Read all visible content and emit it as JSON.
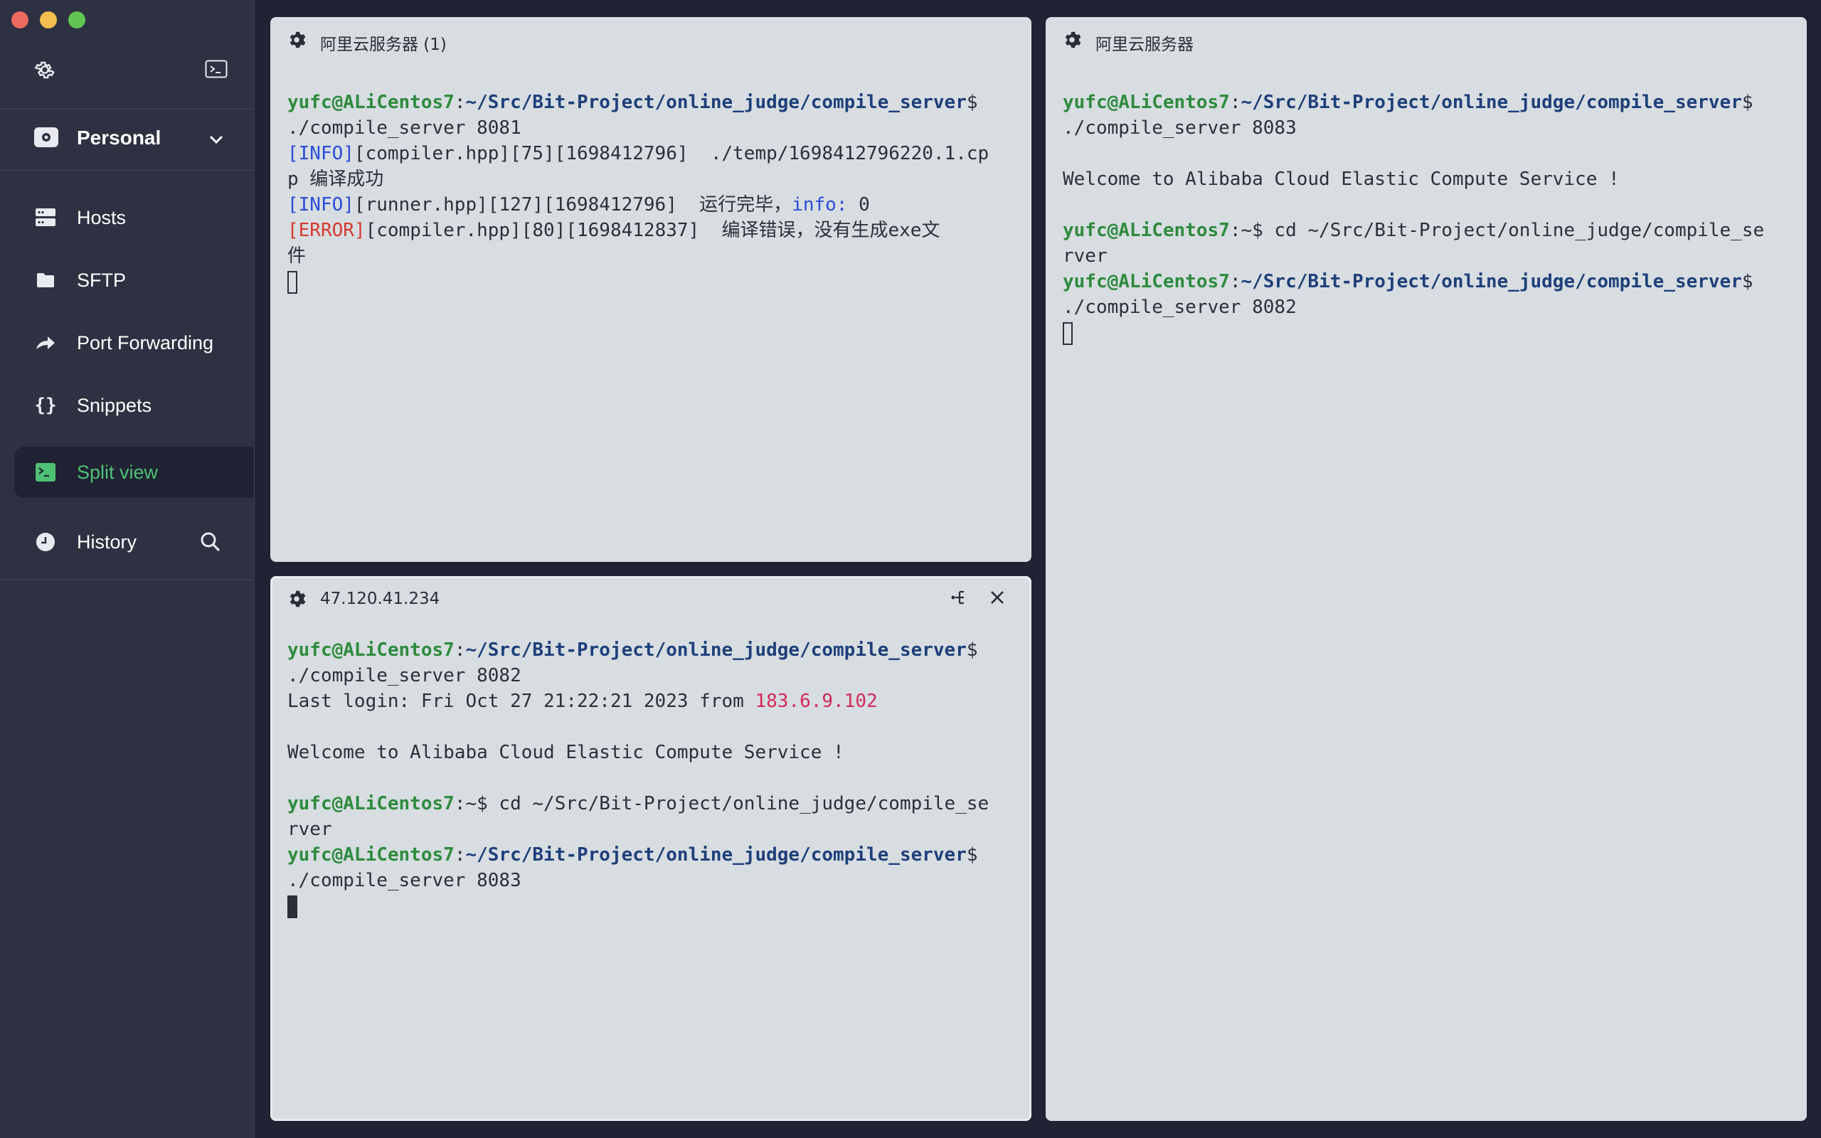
{
  "sidebar": {
    "vault_label": "Personal",
    "items": [
      {
        "label": "Hosts"
      },
      {
        "label": "SFTP"
      },
      {
        "label": "Port Forwarding"
      },
      {
        "label": "Snippets"
      },
      {
        "label": "Split view"
      },
      {
        "label": "History"
      }
    ],
    "active_item": "Split view",
    "colors": {
      "background": "#2e3141",
      "active_bg": "#1f2333",
      "active_text": "#4fc174"
    }
  },
  "panels": {
    "top_left": {
      "title": "阿里云服务器 (1)",
      "lines": [
        [
          {
            "t": "yufc@ALiCentos7",
            "c": "u"
          },
          {
            "t": ":",
            "c": ""
          },
          {
            "t": "~/Src/Bit-Project/online_judge/compile_server",
            "c": "p"
          },
          {
            "t": "$",
            "c": ""
          }
        ],
        [
          {
            "t": "./compile_server 8081",
            "c": ""
          }
        ],
        [
          {
            "t": "[INFO]",
            "c": "info"
          },
          {
            "t": "[compiler.hpp][75][1698412796]  ./temp/1698412796220.1.cp",
            "c": ""
          }
        ],
        [
          {
            "t": "p 编译成功",
            "c": ""
          }
        ],
        [
          {
            "t": "[INFO]",
            "c": "info"
          },
          {
            "t": "[runner.hpp][127][1698412796]  运行完毕，",
            "c": ""
          },
          {
            "t": "info:",
            "c": "info"
          },
          {
            "t": " 0",
            "c": ""
          }
        ],
        [
          {
            "t": "[ERROR]",
            "c": "err"
          },
          {
            "t": "[compiler.hpp][80][1698412837]  编译错误，没有生成exe文",
            "c": ""
          }
        ],
        [
          {
            "t": "件",
            "c": ""
          }
        ]
      ],
      "cursor": "hollow"
    },
    "bottom_left": {
      "title": "47.120.41.234",
      "lines": [
        [
          {
            "t": "yufc@ALiCentos7",
            "c": "u"
          },
          {
            "t": ":",
            "c": ""
          },
          {
            "t": "~/Src/Bit-Project/online_judge/compile_server",
            "c": "p"
          },
          {
            "t": "$",
            "c": ""
          }
        ],
        [
          {
            "t": "./compile_server 8082",
            "c": ""
          }
        ],
        [
          {
            "t": "Last login: Fri Oct 27 21:22:21 2023 from ",
            "c": ""
          },
          {
            "t": "183.6.9.102",
            "c": "ip"
          }
        ],
        [
          {
            "t": "",
            "c": ""
          }
        ],
        [
          {
            "t": "Welcome to Alibaba Cloud Elastic Compute Service !",
            "c": ""
          }
        ],
        [
          {
            "t": "",
            "c": ""
          }
        ],
        [
          {
            "t": "yufc@ALiCentos7",
            "c": "u"
          },
          {
            "t": ":~$ cd ~/Src/Bit-Project/online_judge/compile_se",
            "c": ""
          }
        ],
        [
          {
            "t": "rver",
            "c": ""
          }
        ],
        [
          {
            "t": "yufc@ALiCentos7",
            "c": "u"
          },
          {
            "t": ":",
            "c": ""
          },
          {
            "t": "~/Src/Bit-Project/online_judge/compile_server",
            "c": "p"
          },
          {
            "t": "$",
            "c": ""
          }
        ],
        [
          {
            "t": "./compile_server 8083",
            "c": ""
          }
        ]
      ],
      "cursor": "filled"
    },
    "right": {
      "title": "阿里云服务器",
      "lines": [
        [
          {
            "t": "yufc@ALiCentos7",
            "c": "u"
          },
          {
            "t": ":",
            "c": ""
          },
          {
            "t": "~/Src/Bit-Project/online_judge/compile_server",
            "c": "p"
          },
          {
            "t": "$",
            "c": ""
          }
        ],
        [
          {
            "t": "./compile_server 8083",
            "c": ""
          }
        ],
        [
          {
            "t": "",
            "c": ""
          }
        ],
        [
          {
            "t": "Welcome to Alibaba Cloud Elastic Compute Service !",
            "c": ""
          }
        ],
        [
          {
            "t": "",
            "c": ""
          }
        ],
        [
          {
            "t": "yufc@ALiCentos7",
            "c": "u"
          },
          {
            "t": ":~$ cd ~/Src/Bit-Project/online_judge/compile_se",
            "c": ""
          }
        ],
        [
          {
            "t": "rver",
            "c": ""
          }
        ],
        [
          {
            "t": "yufc@ALiCentos7",
            "c": "u"
          },
          {
            "t": ":",
            "c": ""
          },
          {
            "t": "~/Src/Bit-Project/online_judge/compile_server",
            "c": "p"
          },
          {
            "t": "$",
            "c": ""
          }
        ],
        [
          {
            "t": "./compile_server 8082",
            "c": ""
          }
        ]
      ],
      "cursor": "hollow"
    }
  },
  "icons": [
    "gear-icon",
    "terminal-icon",
    "vault-icon",
    "chevron-down-icon",
    "hosts-icon",
    "folder-icon",
    "port-forwarding-icon",
    "snippets-icon",
    "split-view-icon",
    "history-icon",
    "search-icon",
    "split-icon",
    "close-icon"
  ],
  "colors": {
    "panel_bg": "#d7dde1",
    "user": "#2e8b3e",
    "path": "#1e3f7a",
    "info": "#2b4cd8",
    "error": "#d63a2e",
    "ip": "#d42a5a"
  }
}
